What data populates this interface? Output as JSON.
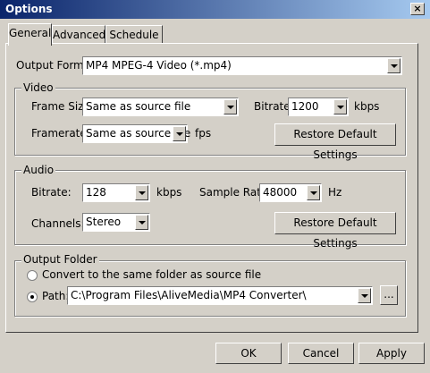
{
  "window": {
    "title": "Options",
    "close_glyph": "×"
  },
  "tabs": [
    "General",
    "Advanced",
    "Schedule"
  ],
  "output_format": {
    "label": "Output Format:",
    "value": "MP4 MPEG-4 Video (*.mp4)"
  },
  "video": {
    "legend": "Video",
    "frame_size_label": "Frame Size:",
    "frame_size_value": "Same as source file",
    "bitrate_label": "Bitrate:",
    "bitrate_value": "1200",
    "bitrate_unit": "kbps",
    "framerate_label": "Framerate:",
    "framerate_value": "Same as source file",
    "framerate_unit": "fps",
    "restore_label": "Restore Default Settings"
  },
  "audio": {
    "legend": "Audio",
    "bitrate_label": "Bitrate:",
    "bitrate_value": "128",
    "bitrate_unit": "kbps",
    "sample_rate_label": "Sample Rate:",
    "sample_rate_value": "48000",
    "sample_rate_unit": "Hz",
    "channels_label": "Channels:",
    "channels_value": "Stereo",
    "restore_label": "Restore Default Settings"
  },
  "output_folder": {
    "legend": "Output Folder",
    "same_folder_label": "Convert to the same folder as source file",
    "path_label": "Path:",
    "path_value": "C:\\Program Files\\AliveMedia\\MP4 Converter\\",
    "browse_label": "...",
    "selected": "path"
  },
  "buttons": {
    "ok": "OK",
    "cancel": "Cancel",
    "apply": "Apply"
  }
}
